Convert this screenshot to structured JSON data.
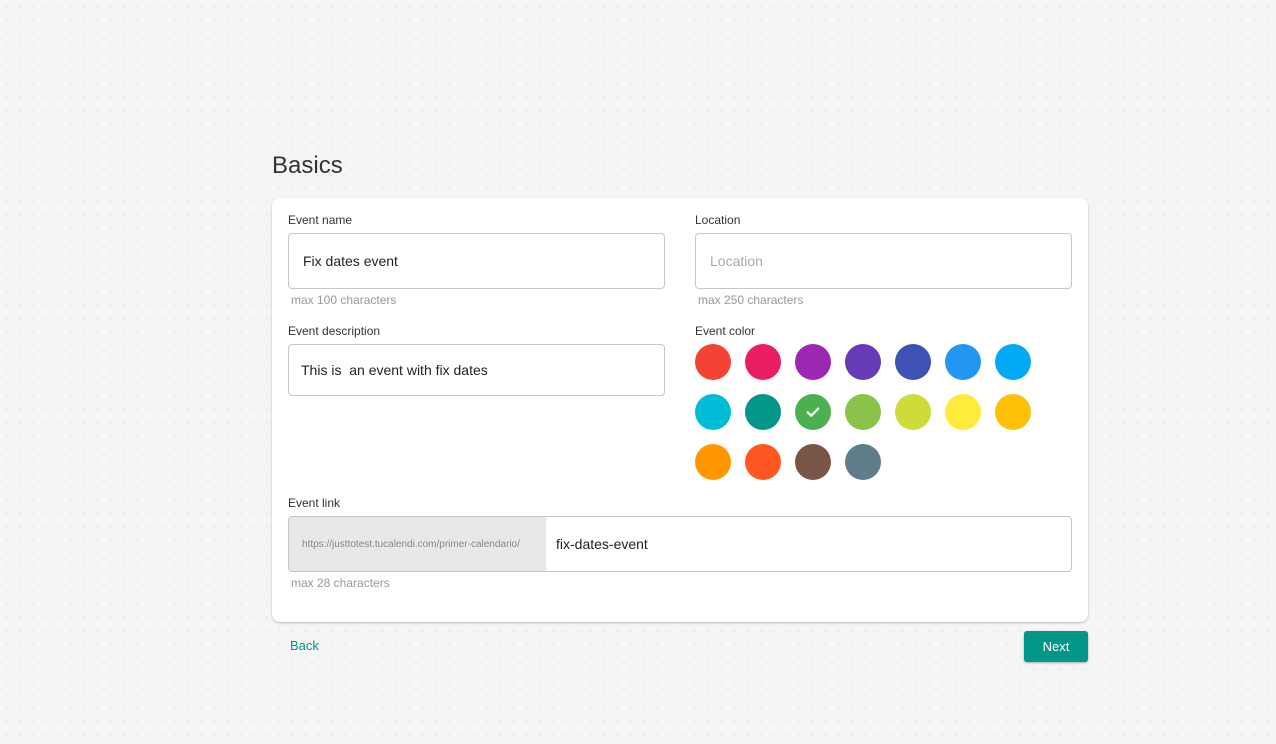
{
  "page": {
    "title": "Basics"
  },
  "form": {
    "event_name": {
      "label": "Event name",
      "value": "Fix dates event",
      "hint": "max 100 characters"
    },
    "location": {
      "label": "Location",
      "value": "",
      "placeholder": "Location",
      "hint": "max 250 characters"
    },
    "description": {
      "label": "Event description",
      "value": "This is  an event with fix dates"
    },
    "color": {
      "label": "Event color",
      "selected_index": 9,
      "options": [
        {
          "name": "red",
          "hex": "#f44336"
        },
        {
          "name": "pink",
          "hex": "#e91e63"
        },
        {
          "name": "purple",
          "hex": "#9c27b0"
        },
        {
          "name": "deep-purple",
          "hex": "#673ab7"
        },
        {
          "name": "indigo",
          "hex": "#3f51b5"
        },
        {
          "name": "blue",
          "hex": "#2196f3"
        },
        {
          "name": "light-blue",
          "hex": "#03a9f4"
        },
        {
          "name": "cyan",
          "hex": "#00bcd4"
        },
        {
          "name": "teal",
          "hex": "#009688"
        },
        {
          "name": "green",
          "hex": "#4caf50"
        },
        {
          "name": "light-green",
          "hex": "#8bc34a"
        },
        {
          "name": "lime",
          "hex": "#cddc39"
        },
        {
          "name": "yellow",
          "hex": "#ffeb3b"
        },
        {
          "name": "amber",
          "hex": "#ffc107"
        },
        {
          "name": "orange",
          "hex": "#ff9800"
        },
        {
          "name": "deep-orange",
          "hex": "#ff5722"
        },
        {
          "name": "brown",
          "hex": "#795548"
        },
        {
          "name": "blue-grey",
          "hex": "#607d8b"
        }
      ],
      "selected_icon": "check-icon"
    },
    "event_link": {
      "label": "Event link",
      "prefix": "https://justtotest.tucalendi.com/primer-calendario/",
      "value": "fix-dates-event",
      "hint": "max 28 characters"
    }
  },
  "actions": {
    "back_label": "Back",
    "next_label": "Next",
    "accent": "#009688"
  }
}
